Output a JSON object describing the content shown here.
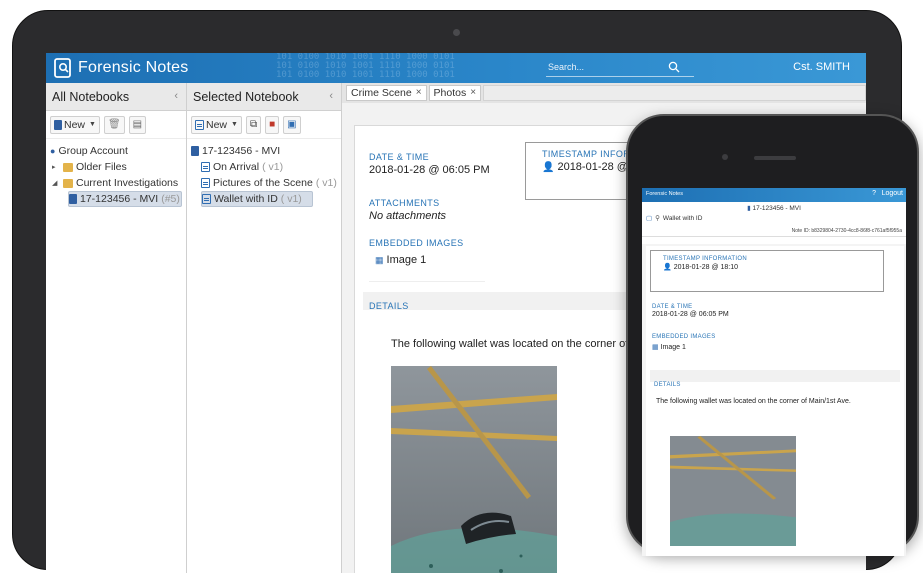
{
  "app": {
    "name": "Forensic Notes",
    "search_placeholder": "Search...",
    "user": "Cst. SMITH",
    "header_digits": "101 0100 1010 1001 1110 1000 0101"
  },
  "left_panel": {
    "title": "All Notebooks",
    "new_label": "New",
    "tree": [
      {
        "label": "Group Account",
        "extra": ""
      },
      {
        "label": "Older Files",
        "extra": ""
      },
      {
        "label": "Current Investigations",
        "extra": ""
      },
      {
        "label": "17-123456 - MVI",
        "extra": "(#5)"
      }
    ]
  },
  "middle_panel": {
    "title": "Selected Notebook",
    "new_label": "New",
    "notebook": "17-123456 - MVI",
    "notes": [
      {
        "label": "On Arrival",
        "version": "( v1)"
      },
      {
        "label": "Pictures of the Scene",
        "version": "( v1)"
      },
      {
        "label": "Wallet with ID",
        "version": "( v1)"
      }
    ]
  },
  "main": {
    "tabs": [
      {
        "label": "Crime Scene"
      },
      {
        "label": "Photos"
      }
    ],
    "tab_close": "×",
    "date_time_label": "Date & Time",
    "date_time_value": "2018-01-28 @ 06:05 PM",
    "timestamp_label": "TIMESTAMP INFORM",
    "timestamp_value": "2018-01-28 @ 18",
    "attachments_label": "Attachments",
    "attachments_value": "No attachments",
    "embedded_label": "Embedded Images",
    "embedded_value": "Image 1",
    "details_label": "Details",
    "details_text": "The following wallet was located on the corner of Main"
  },
  "phone": {
    "app_name": "Forensic Notes",
    "help": "?",
    "logout": "Logout",
    "notebook": "17-123456 - MVI",
    "note_title": "Wallet with ID",
    "note_id": "Note ID: b8329804-2730-4cc8-86f8-c761af5f955a",
    "timestamp_label": "TIMESTAMP INFORMATION",
    "timestamp_value": "2018-01-28 @ 18:10",
    "date_time_label": "Date & Time",
    "date_time_value": "2018-01-28 @ 06:05 PM",
    "embedded_label": "Embedded Images",
    "embedded_value": "Image 1",
    "details_label": "Details",
    "details_text": "The following wallet was located on the corner of Main/1st Ave."
  },
  "colors": {
    "brand_blue": "#2a86c9",
    "label_blue": "#2874b6"
  }
}
